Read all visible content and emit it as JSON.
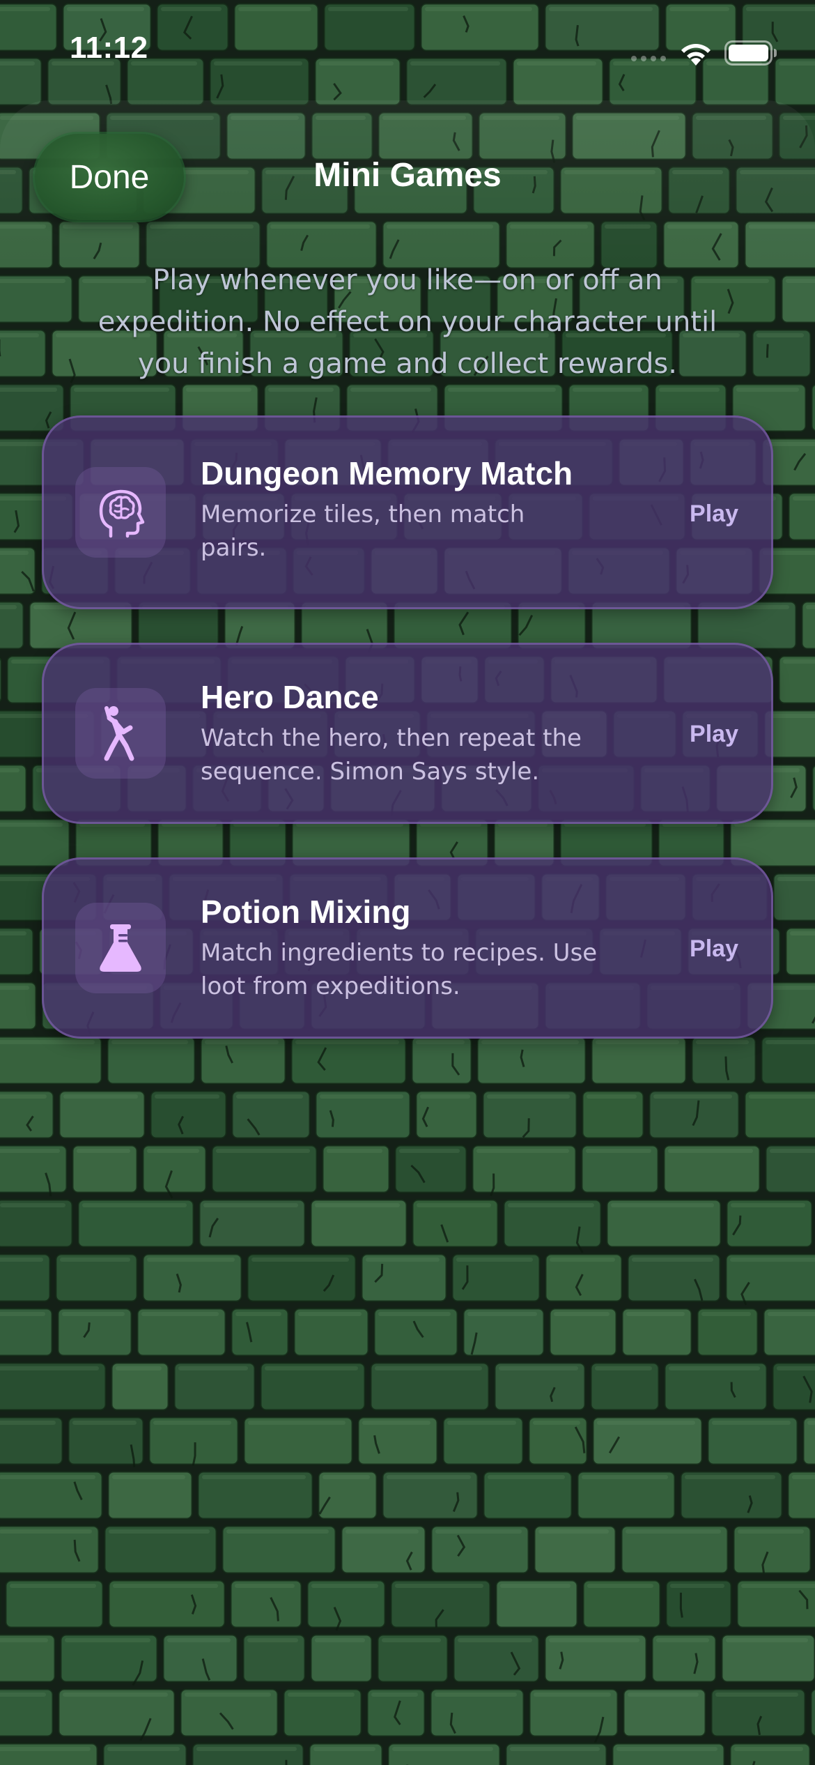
{
  "status_bar": {
    "time": "11:12",
    "wifi_icon": "wifi-icon",
    "battery_icon": "battery-full-icon"
  },
  "nav": {
    "done_label": "Done",
    "title": "Mini Games"
  },
  "intro": "Play whenever you like—on or off an expedition. No effect on your character until you finish a game and collect rewards.",
  "games": [
    {
      "icon": "brain-head-icon",
      "title": "Dungeon Memory Match",
      "description": "Memorize tiles, then match pairs.",
      "action": "Play"
    },
    {
      "icon": "dancing-figure-icon",
      "title": "Hero Dance",
      "description": "Watch the hero, then repeat the sequence. Simon Says style.",
      "action": "Play"
    },
    {
      "icon": "flask-icon",
      "title": "Potion Mixing",
      "description": "Match ingredients to recipes. Use loot from expeditions.",
      "action": "Play"
    }
  ],
  "colors": {
    "card_background": "#48326e",
    "card_border": "#8c6ebe",
    "accent_icon": "#e6b8ff",
    "play_text": "#c9b8ef",
    "done_button": "#2a6035",
    "wall_brick": "#3e6d48",
    "wall_mortar": "#1a2a1d"
  }
}
